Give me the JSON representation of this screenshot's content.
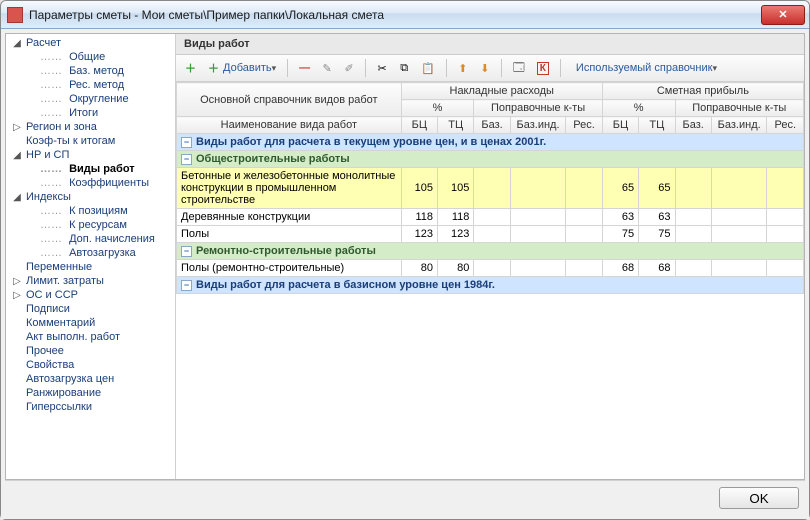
{
  "window": {
    "title": "Параметры сметы - Мои сметы\\Пример папки\\Локальная смета",
    "close_glyph": "✕"
  },
  "sidebar": {
    "items": [
      {
        "label": "Расчет",
        "level": 0,
        "arrow": "◢"
      },
      {
        "label": "Общие",
        "level": 1
      },
      {
        "label": "Баз. метод",
        "level": 1
      },
      {
        "label": "Рес. метод",
        "level": 1
      },
      {
        "label": "Округление",
        "level": 1
      },
      {
        "label": "Итоги",
        "level": 1
      },
      {
        "label": "Регион и зона",
        "level": 0,
        "arrow": "▷"
      },
      {
        "label": "Коэф-ты к итогам",
        "level": 0
      },
      {
        "label": "НР и СП",
        "level": 0,
        "arrow": "◢"
      },
      {
        "label": "Виды работ",
        "level": 1,
        "selected": true
      },
      {
        "label": "Коэффициенты",
        "level": 1
      },
      {
        "label": "Индексы",
        "level": 0,
        "arrow": "◢"
      },
      {
        "label": "К позициям",
        "level": 1
      },
      {
        "label": "К ресурсам",
        "level": 1
      },
      {
        "label": "Доп. начисления",
        "level": 1
      },
      {
        "label": "Автозагрузка",
        "level": 1
      },
      {
        "label": "Переменные",
        "level": 0
      },
      {
        "label": "Лимит. затраты",
        "level": 0,
        "arrow": "▷"
      },
      {
        "label": "ОС и ССР",
        "level": 0,
        "arrow": "▷"
      },
      {
        "label": "Подписи",
        "level": 0
      },
      {
        "label": "Комментарий",
        "level": 0
      },
      {
        "label": "Акт выполн. работ",
        "level": 0
      },
      {
        "label": "Прочее",
        "level": 0
      },
      {
        "label": "Свойства",
        "level": 0
      },
      {
        "label": "Автозагрузка цен",
        "level": 0
      },
      {
        "label": "Ранжирование",
        "level": 0
      },
      {
        "label": "Гиперссылки",
        "level": 0
      }
    ]
  },
  "panel_title": "Виды работ",
  "toolbar": {
    "add_label": "Добавить",
    "ref_label": "Используемый справочник"
  },
  "grid": {
    "group1_top": "Основной справочник видов работ",
    "group2_top": "Накладные расходы",
    "group3_top": "Сметная прибыль",
    "sub_pct": "%",
    "sub_k": "Поправочные к-ты",
    "h_name": "Наименование вида работ",
    "h_bc": "БЦ",
    "h_tc": "ТЦ",
    "h_baz": "Баз.",
    "h_bazind": "Баз.инд.",
    "h_res": "Рес.",
    "section_blue_1": "Виды работ для расчета в текущем уровне цен, и в ценах 2001г.",
    "section_green_1": "Общестроительные работы",
    "section_green_2": "Ремонтно-строительные работы",
    "section_blue_2": "Виды работ для расчета в базисном уровне цен 1984г.",
    "rows": [
      {
        "name": "Бетонные и железобетонные монолитные конструкции в промышленном строительстве",
        "nr_bc": 105,
        "nr_tc": 105,
        "sp_bc": 65,
        "sp_tc": 65,
        "highlight": true
      },
      {
        "name": "Деревянные конструкции",
        "nr_bc": 118,
        "nr_tc": 118,
        "sp_bc": 63,
        "sp_tc": 63
      },
      {
        "name": "Полы",
        "nr_bc": 123,
        "nr_tc": 123,
        "sp_bc": 75,
        "sp_tc": 75
      },
      {
        "name": "Полы (ремонтно-строительные)",
        "nr_bc": 80,
        "nr_tc": 80,
        "sp_bc": 68,
        "sp_tc": 68
      }
    ]
  },
  "footer": {
    "ok_label": "OK"
  }
}
